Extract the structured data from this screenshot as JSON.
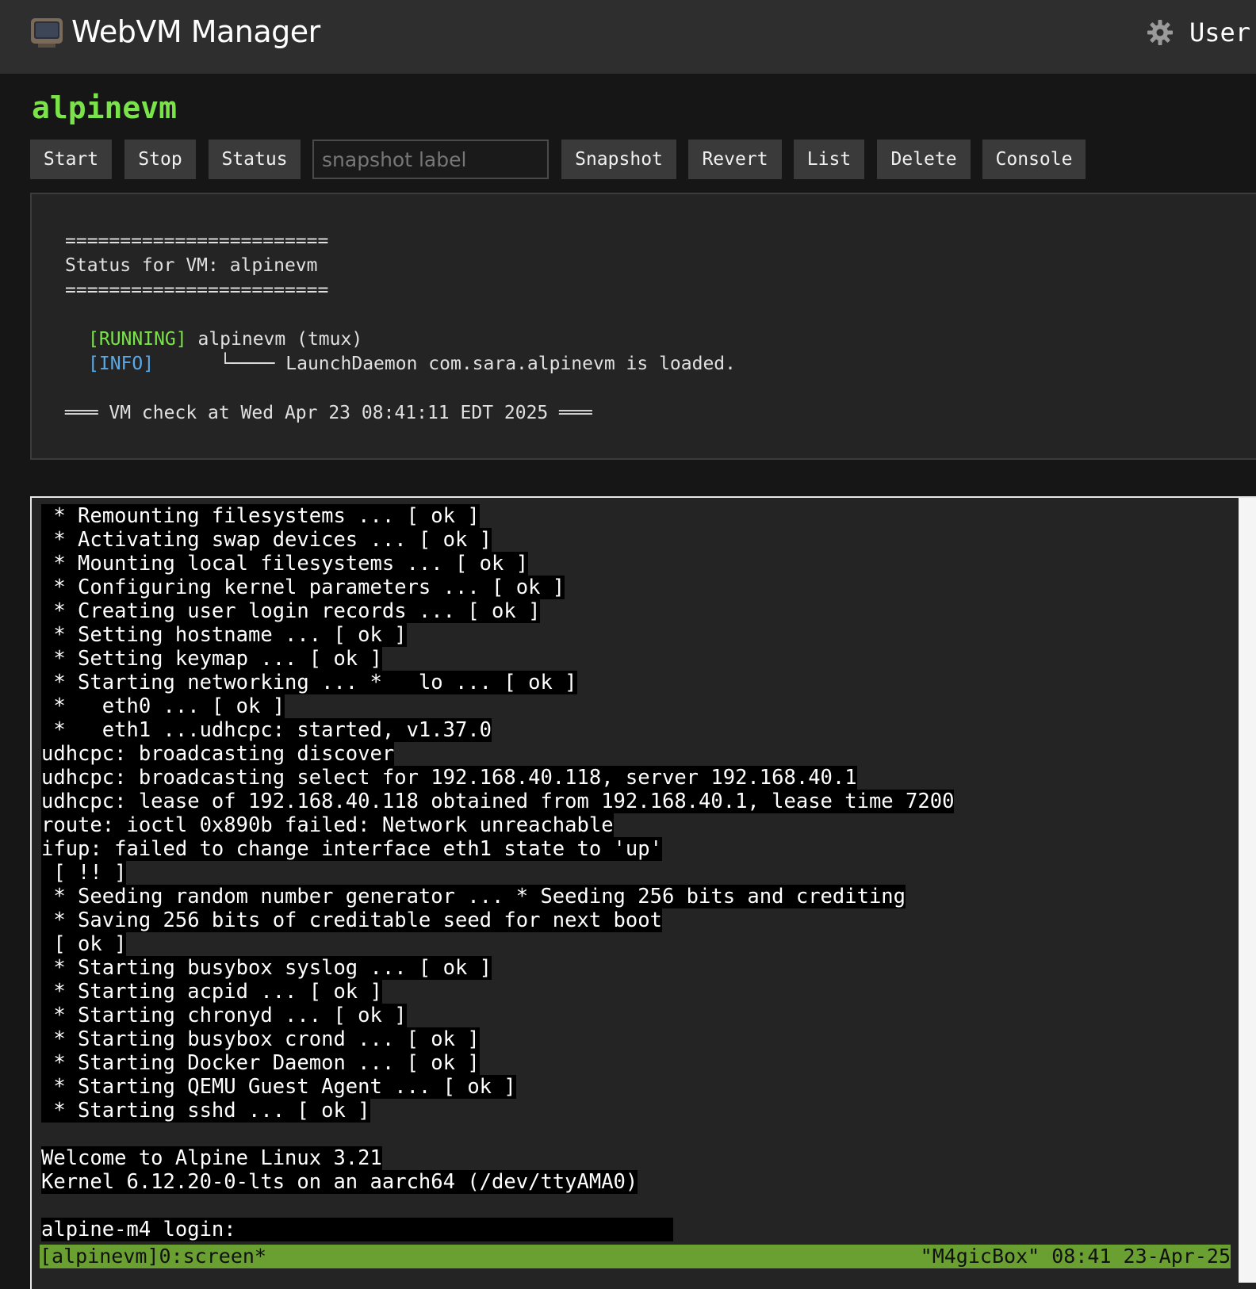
{
  "header": {
    "app_icon": "computer-monitor-icon",
    "title": "WebVM Manager",
    "settings_icon": "gear-icon",
    "user_label": "User"
  },
  "vm": {
    "name": "alpinevm"
  },
  "toolbar": {
    "start": "Start",
    "stop": "Stop",
    "status": "Status",
    "snapshot_placeholder": "snapshot label",
    "snapshot_value": "",
    "snapshot": "Snapshot",
    "revert": "Revert",
    "list": "List",
    "delete": "Delete",
    "console": "Console"
  },
  "status_panel": {
    "sep1": "========================",
    "title": "Status for VM: alpinevm",
    "sep2": "========================",
    "running_tag": "[RUNNING]",
    "running_text": " alpinevm (tmux)",
    "info_tag": "[INFO]",
    "info_text": "      └──── LaunchDaemon com.sara.alpinevm is loaded.",
    "check_line": "═══ VM check at Wed Apr 23 08:41:11 EDT 2025 ═══"
  },
  "console": {
    "lines": [
      " * Remounting filesystems ... [ ok ]",
      " * Activating swap devices ... [ ok ]",
      " * Mounting local filesystems ... [ ok ]",
      " * Configuring kernel parameters ... [ ok ]",
      " * Creating user login records ... [ ok ]",
      " * Setting hostname ... [ ok ]",
      " * Setting keymap ... [ ok ]",
      " * Starting networking ... *   lo ... [ ok ]",
      " *   eth0 ... [ ok ]",
      " *   eth1 ...udhcpc: started, v1.37.0",
      "udhcpc: broadcasting discover",
      "udhcpc: broadcasting select for 192.168.40.118, server 192.168.40.1",
      "udhcpc: lease of 192.168.40.118 obtained from 192.168.40.1, lease time 7200",
      "route: ioctl 0x890b failed: Network unreachable",
      "ifup: failed to change interface eth1 state to 'up'",
      " [ !! ]",
      " * Seeding random number generator ... * Seeding 256 bits and crediting",
      " * Saving 256 bits of creditable seed for next boot",
      " [ ok ]",
      " * Starting busybox syslog ... [ ok ]",
      " * Starting acpid ... [ ok ]",
      " * Starting chronyd ... [ ok ]",
      " * Starting busybox crond ... [ ok ]",
      " * Starting Docker Daemon ... [ ok ]",
      " * Starting QEMU Guest Agent ... [ ok ]",
      " * Starting sshd ... [ ok ]",
      "",
      "Welcome to Alpine Linux 3.21",
      "Kernel 6.12.20-0-lts on an aarch64 (/dev/ttyAMA0)",
      "",
      "alpine-m4 login: "
    ],
    "statusbar_left": "[alpinevm]0:screen*",
    "statusbar_right": "\"M4gicBox\" 08:41 23-Apr-25",
    "statusbar_color": "#6aa032"
  },
  "colors": {
    "accent_green": "#7be34a",
    "info_blue": "#5aa9e6"
  }
}
